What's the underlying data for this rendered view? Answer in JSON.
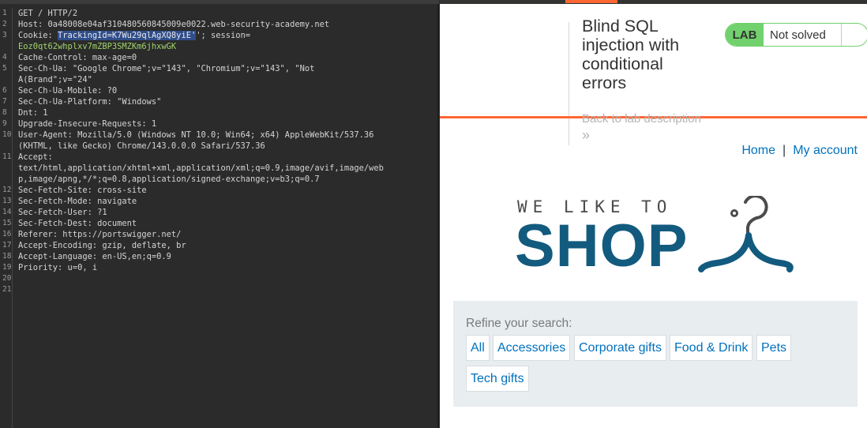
{
  "request": {
    "lines": [
      {
        "num": "1",
        "segments": [
          {
            "text": "GET / HTTP/2"
          }
        ]
      },
      {
        "num": "2",
        "segments": [
          {
            "text": "Host: 0a48008e04af310480560845009e0022.web-security-academy.net"
          }
        ]
      },
      {
        "num": "3",
        "segments": [
          {
            "text": "Cookie: "
          },
          {
            "text": "TrackingId=K7Wu29qlAgXQ8yiE'",
            "style": "hl"
          },
          {
            "text": "'; session="
          }
        ]
      },
      {
        "num": "",
        "segments": [
          {
            "text": "Eoz0qt62whplxv7mZBP3SMZKm6jhxwGK",
            "style": "green"
          }
        ]
      },
      {
        "num": "4",
        "segments": [
          {
            "text": "Cache-Control: max-age=0"
          }
        ]
      },
      {
        "num": "5",
        "segments": [
          {
            "text": "Sec-Ch-Ua: \"Google Chrome\";v=\"143\", \"Chromium\";v=\"143\", \"Not"
          }
        ]
      },
      {
        "num": "",
        "segments": [
          {
            "text": "A(Brand\";v=\"24\""
          }
        ]
      },
      {
        "num": "6",
        "segments": [
          {
            "text": "Sec-Ch-Ua-Mobile: ?0"
          }
        ]
      },
      {
        "num": "7",
        "segments": [
          {
            "text": "Sec-Ch-Ua-Platform: \"Windows\""
          }
        ]
      },
      {
        "num": "8",
        "segments": [
          {
            "text": "Dnt: 1"
          }
        ]
      },
      {
        "num": "9",
        "segments": [
          {
            "text": "Upgrade-Insecure-Requests: 1"
          }
        ]
      },
      {
        "num": "10",
        "segments": [
          {
            "text": "User-Agent: Mozilla/5.0 (Windows NT 10.0; Win64; x64) AppleWebKit/537.36"
          }
        ]
      },
      {
        "num": "",
        "segments": [
          {
            "text": "(KHTML, like Gecko) Chrome/143.0.0.0 Safari/537.36"
          }
        ]
      },
      {
        "num": "11",
        "segments": [
          {
            "text": "Accept:"
          }
        ]
      },
      {
        "num": "",
        "segments": [
          {
            "text": "text/html,application/xhtml+xml,application/xml;q=0.9,image/avif,image/web"
          }
        ]
      },
      {
        "num": "",
        "segments": [
          {
            "text": "p,image/apng,*/*;q=0.8,application/signed-exchange;v=b3;q=0.7"
          }
        ]
      },
      {
        "num": "12",
        "segments": [
          {
            "text": "Sec-Fetch-Site: cross-site"
          }
        ]
      },
      {
        "num": "13",
        "segments": [
          {
            "text": "Sec-Fetch-Mode: navigate"
          }
        ]
      },
      {
        "num": "14",
        "segments": [
          {
            "text": "Sec-Fetch-User: ?1"
          }
        ]
      },
      {
        "num": "15",
        "segments": [
          {
            "text": "Sec-Fetch-Dest: document"
          }
        ]
      },
      {
        "num": "16",
        "segments": [
          {
            "text": "Referer: https://portswigger.net/"
          }
        ]
      },
      {
        "num": "17",
        "segments": [
          {
            "text": "Accept-Encoding: gzip, deflate, br"
          }
        ]
      },
      {
        "num": "18",
        "segments": [
          {
            "text": "Accept-Language: en-US,en;q=0.9"
          }
        ]
      },
      {
        "num": "19",
        "segments": [
          {
            "text": "Priority: u=0, i"
          }
        ]
      },
      {
        "num": "20",
        "segments": [
          {
            "text": ""
          }
        ]
      },
      {
        "num": "21",
        "segments": [
          {
            "text": ""
          }
        ]
      }
    ]
  },
  "lab": {
    "title_lines": [
      "Blind SQL",
      "injection with",
      "conditional",
      "errors"
    ],
    "badge": "LAB",
    "status": "Not solved",
    "back_link": "Back to lab description",
    "back_chevron": "»"
  },
  "nav": {
    "home": "Home",
    "separator": "|",
    "account": "My account"
  },
  "logo": {
    "tagline": "WE LIKE TO",
    "word": "SHOP"
  },
  "refine": {
    "label": "Refine your search:",
    "chips": [
      "All",
      "Accessories",
      "Corporate gifts",
      "Food & Drink",
      "Pets",
      "Tech gifts"
    ]
  },
  "colors": {
    "accent": "#ff6633",
    "link": "#0071bc",
    "brand": "#135a7f",
    "lab_green": "#70d16d"
  }
}
